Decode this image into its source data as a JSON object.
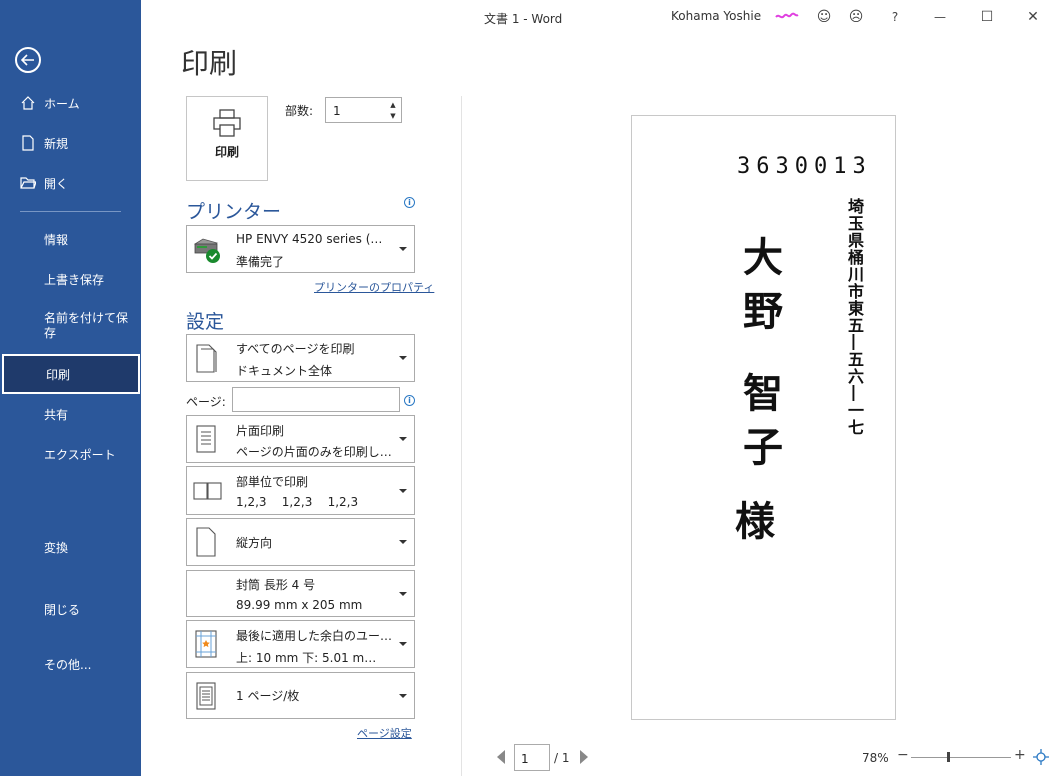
{
  "window": {
    "doc_title": "文書 1  -  Word",
    "user_name": "Kohama Yoshie",
    "smile_glyph": "☺",
    "frown_glyph": "☹",
    "help": "?",
    "minimize": "—",
    "maximize": "☐",
    "close": "✕"
  },
  "sidebar": {
    "items": [
      {
        "label": "ホーム",
        "icon": "home-icon"
      },
      {
        "label": "新規",
        "icon": "new-document-icon"
      },
      {
        "label": "開く",
        "icon": "open-folder-icon"
      },
      {
        "label": "情報"
      },
      {
        "label": "上書き保存"
      },
      {
        "label": "名前を付けて保",
        "label2": "存"
      },
      {
        "label": "印刷"
      },
      {
        "label": "共有"
      },
      {
        "label": "エクスポート"
      },
      {
        "label": "変換"
      },
      {
        "label": "閉じる"
      },
      {
        "label": "その他..."
      }
    ]
  },
  "print": {
    "title": "印刷",
    "button_label": "印刷",
    "copies_label": "部数:",
    "copies_value": "1",
    "printer_heading": "プリンター",
    "printer_name": "HP ENVY 4520 series (…",
    "printer_status": "準備完了",
    "printer_properties": "プリンターのプロパティ",
    "settings_heading": "設定",
    "pages_label": "ページ:",
    "pages_value": "",
    "settings": [
      {
        "line1": "すべてのページを印刷",
        "line2": "ドキュメント全体"
      },
      {
        "line1": "片面印刷",
        "line2": "ページの片面のみを印刷し…"
      },
      {
        "line1": "部単位で印刷",
        "line2": "1,2,3    1,2,3    1,2,3"
      },
      {
        "line1": "縦方向",
        "line2": ""
      },
      {
        "line1": "封筒 長形 4 号",
        "line2": "89.99 mm x 205 mm"
      },
      {
        "line1": "最後に適用した余白のユー…",
        "line2": "上: 10 mm 下: 5.01 m…"
      },
      {
        "line1": "1 ページ/枚",
        "line2": ""
      }
    ],
    "page_setup_link": "ページ設定"
  },
  "preview": {
    "postal_code": "3630013",
    "address": "埼玉県桶川市東五―五六―一七",
    "recipient": "大野 智子",
    "honorific": "様",
    "page_current": "1",
    "page_total": "/ 1",
    "zoom": "78%",
    "zoom_level_percent": 78,
    "zoom_minus": "−",
    "zoom_plus": "+"
  }
}
